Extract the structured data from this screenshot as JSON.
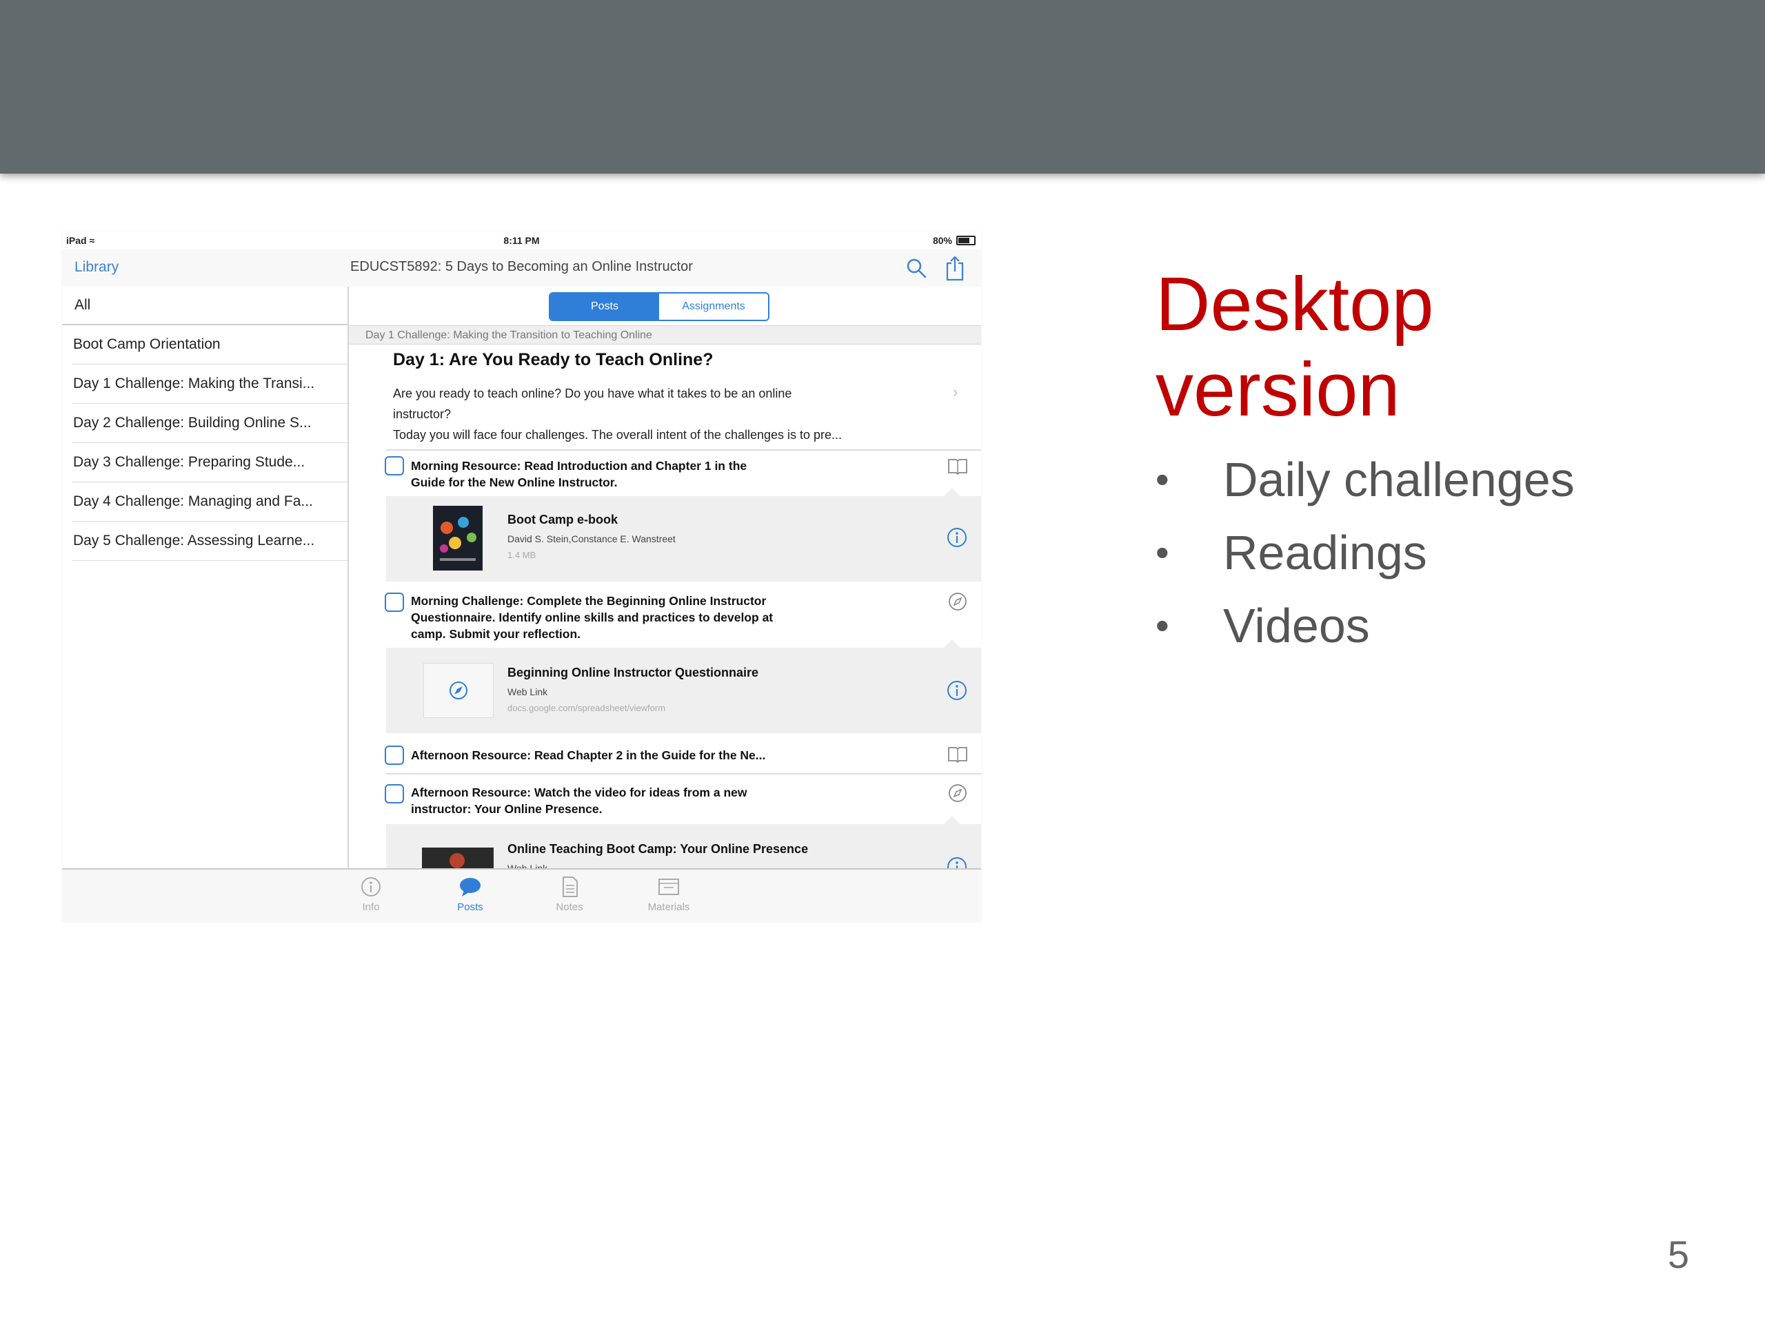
{
  "status_bar": {
    "device": "iPad",
    "time": "8:11 PM",
    "battery": "80%"
  },
  "nav": {
    "back_label": "Library",
    "title": "EDUCST5892: 5 Days to Becoming an Online Instructor"
  },
  "sidebar": {
    "items": [
      "All",
      "Boot Camp Orientation",
      "Day 1 Challenge: Making the Transi...",
      "Day 2 Challenge: Building Online S...",
      "Day 3 Challenge: Preparing  Stude...",
      "Day 4 Challenge: Managing and Fa...",
      "Day 5 Challenge: Assessing Learne..."
    ]
  },
  "segments": {
    "posts": "Posts",
    "assignments": "Assignments"
  },
  "section_header": "Day 1 Challenge: Making the Transition to Teaching Online",
  "post": {
    "title": "Day 1: Are You Ready to Teach Online?",
    "body_line1": "Are you ready to teach online? Do you have what it takes to be an online",
    "body_line2": "instructor?",
    "body_line3": "Today you will face four challenges. The overall intent of the challenges is to pre..."
  },
  "tasks": {
    "t1_line1": "Morning Resource: Read Introduction and Chapter 1 in the",
    "t1_line2": "Guide for the New Online Instructor.",
    "t2_line1": "Morning Challenge: Complete the Beginning Online Instructor",
    "t2_line2": "Questionnaire. Identify online skills and practices to develop at",
    "t2_line3": "camp. Submit your reflection.",
    "t3_line1": "Afternoon Resource: Read Chapter 2 in the Guide for the Ne...",
    "t4_line1": "Afternoon Resource: Watch the video for ideas from a new",
    "t4_line2": "instructor: Your Online Presence."
  },
  "cards": {
    "c1_title": "Boot Camp e-book",
    "c1_sub": "David S. Stein,Constance E. Wanstreet",
    "c1_meta": "1.4 MB",
    "c2_title": "Beginning Online Instructor Questionnaire",
    "c2_sub": "Web Link",
    "c2_meta": "docs.google.com/spreadsheet/viewform",
    "c3_title": "Online Teaching Boot Camp: Your Online Presence",
    "c3_sub": "Web Link"
  },
  "tabs": {
    "info": "Info",
    "posts": "Posts",
    "notes": "Notes",
    "materials": "Materials"
  },
  "slide": {
    "heading_line1": "Desktop",
    "heading_line2": "version",
    "bullets": [
      "Daily challenges",
      "Readings",
      "Videos"
    ],
    "page_number": "5"
  },
  "colors": {
    "accent": "#2f7fd8",
    "heading": "#c00000",
    "topbar": "#636a6d"
  }
}
